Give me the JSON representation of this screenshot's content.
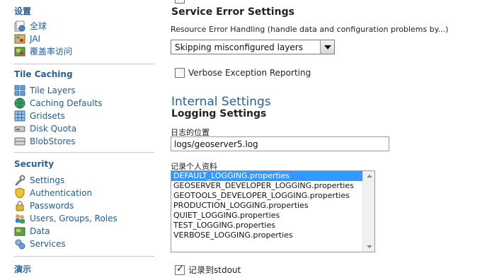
{
  "sidebar": {
    "settings_section": {
      "title": "设置",
      "items": [
        {
          "label": "全球",
          "icon": "globe-settings-icon"
        },
        {
          "label": "JAI",
          "icon": "jai-image-icon"
        },
        {
          "label": "覆盖率访问",
          "icon": "coverage-access-icon"
        }
      ]
    },
    "tile_caching_section": {
      "title": "Tile Caching",
      "items": [
        {
          "label": "Tile Layers",
          "icon": "tile-layers-icon"
        },
        {
          "label": "Caching Defaults",
          "icon": "caching-defaults-icon"
        },
        {
          "label": "Gridsets",
          "icon": "gridsets-icon"
        },
        {
          "label": "Disk Quota",
          "icon": "disk-quota-icon"
        },
        {
          "label": "BlobStores",
          "icon": "blobstores-icon"
        }
      ]
    },
    "security_section": {
      "title": "Security",
      "items": [
        {
          "label": "Settings",
          "icon": "wrench-icon"
        },
        {
          "label": "Authentication",
          "icon": "shield-icon"
        },
        {
          "label": "Passwords",
          "icon": "lock-icon"
        },
        {
          "label": "Users, Groups, Roles",
          "icon": "users-icon"
        },
        {
          "label": "Data",
          "icon": "data-icon"
        },
        {
          "label": "Services",
          "icon": "services-icon"
        }
      ]
    },
    "demos_section": {
      "title": "演示"
    }
  },
  "main": {
    "service_error": {
      "heading": "Service Error Settings",
      "resource_label": "Resource Error Handling (handle data and configuration problems by...)",
      "selected_option": "Skipping misconfigured layers"
    },
    "verbose": {
      "label": "Verbose Exception Reporting",
      "checked": false
    },
    "internal_heading": "Internal Settings",
    "logging_heading": "Logging Settings",
    "log_location": {
      "label": "日志的位置",
      "value": "logs/geoserver5.log"
    },
    "log_profile": {
      "label": "记录个人资料",
      "options": [
        "DEFAULT_LOGGING.properties",
        "GEOSERVER_DEVELOPER_LOGGING.properties",
        "GEOTOOLS_DEVELOPER_LOGGING.properties",
        "PRODUCTION_LOGGING.properties",
        "QUIET_LOGGING.properties",
        "TEST_LOGGING.properties",
        "VERBOSE_LOGGING.properties"
      ],
      "selected_index": 0
    },
    "stdout": {
      "label": "记录到stdout",
      "checked": true
    }
  },
  "colors": {
    "link": "#1f5d9b",
    "section_title": "#2a6194",
    "selection": "#3399ff"
  }
}
